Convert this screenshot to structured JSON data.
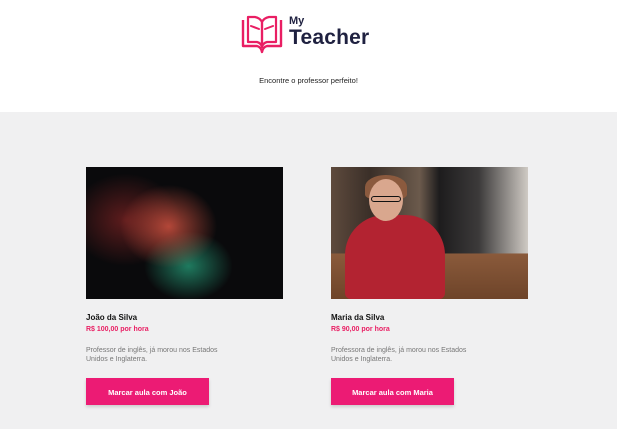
{
  "brand": {
    "small": "My",
    "big": "Teacher",
    "icon": "book-icon",
    "accent_color": "#ec1b74"
  },
  "tagline": "Encontre o professor perfeito!",
  "teachers": [
    {
      "name": "João da Silva",
      "price": "R$ 100,00 por hora",
      "description": "Professor de inglês, já morou nos Estados Unidos e Inglaterra.",
      "button": "Marcar aula com João"
    },
    {
      "name": "Maria da Silva",
      "price": "R$ 90,00 por hora",
      "description": "Professora de inglês, já morou nos Estados Unidos e Inglaterra.",
      "button": "Marcar aula com Maria"
    }
  ]
}
